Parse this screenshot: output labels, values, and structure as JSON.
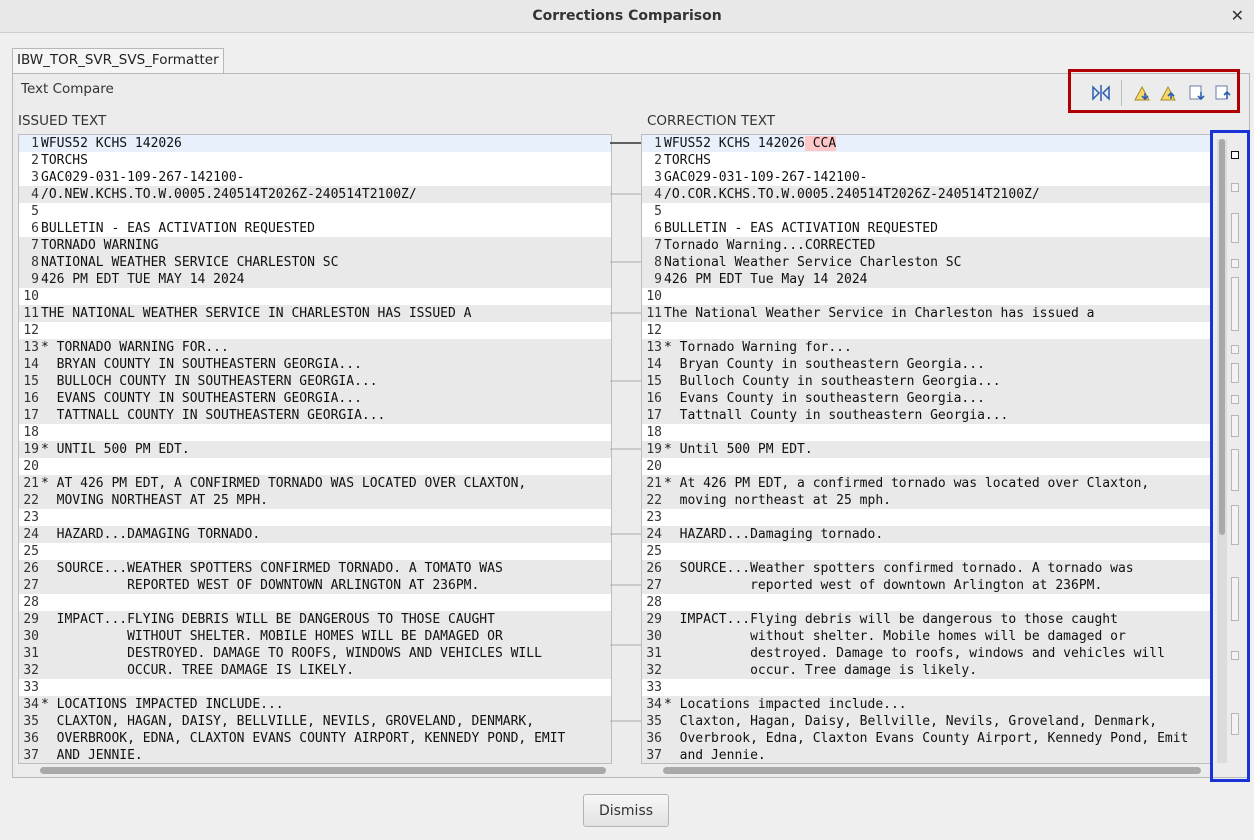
{
  "window": {
    "title": "Corrections Comparison",
    "close_glyph": "✕"
  },
  "tab": {
    "label": "IBW_TOR_SVR_SVS_Formatter"
  },
  "compare_label": "Text Compare",
  "toolbar": {
    "icons": [
      "copy-all-right-icon",
      "next-difference-icon",
      "previous-difference-icon",
      "next-change-icon",
      "previous-change-icon"
    ]
  },
  "left": {
    "header": "ISSUED TEXT",
    "lines": [
      "WFUS52 KCHS 142026",
      "TORCHS",
      "GAC029-031-109-267-142100-",
      "/O.NEW.KCHS.TO.W.0005.240514T2026Z-240514T2100Z/",
      "",
      "BULLETIN - EAS ACTIVATION REQUESTED",
      "TORNADO WARNING",
      "NATIONAL WEATHER SERVICE CHARLESTON SC",
      "426 PM EDT TUE MAY 14 2024",
      "",
      "THE NATIONAL WEATHER SERVICE IN CHARLESTON HAS ISSUED A",
      "",
      "* TORNADO WARNING FOR...",
      "  BRYAN COUNTY IN SOUTHEASTERN GEORGIA...",
      "  BULLOCH COUNTY IN SOUTHEASTERN GEORGIA...",
      "  EVANS COUNTY IN SOUTHEASTERN GEORGIA...",
      "  TATTNALL COUNTY IN SOUTHEASTERN GEORGIA...",
      "",
      "* UNTIL 500 PM EDT.",
      "",
      "* AT 426 PM EDT, A CONFIRMED TORNADO WAS LOCATED OVER CLAXTON,",
      "  MOVING NORTHEAST AT 25 MPH.",
      "",
      "  HAZARD...DAMAGING TORNADO.",
      "",
      "  SOURCE...WEATHER SPOTTERS CONFIRMED TORNADO. A TOMATO WAS",
      "           REPORTED WEST OF DOWNTOWN ARLINGTON AT 236PM.",
      "",
      "  IMPACT...FLYING DEBRIS WILL BE DANGEROUS TO THOSE CAUGHT",
      "           WITHOUT SHELTER. MOBILE HOMES WILL BE DAMAGED OR",
      "           DESTROYED. DAMAGE TO ROOFS, WINDOWS AND VEHICLES WILL",
      "           OCCUR. TREE DAMAGE IS LIKELY.",
      "",
      "* LOCATIONS IMPACTED INCLUDE...",
      "  CLAXTON, HAGAN, DAISY, BELLVILLE, NEVILS, GROVELAND, DENMARK,",
      "  OVERBROOK, EDNA, CLAXTON EVANS COUNTY AIRPORT, KENNEDY POND, EMIT",
      "  AND JENNIE."
    ]
  },
  "right": {
    "header": "CORRECTION TEXT",
    "first_line_main": "WFUS52 KCHS 142026",
    "first_line_added": " CCA",
    "lines": [
      "WFUS52 KCHS 142026 CCA",
      "TORCHS",
      "GAC029-031-109-267-142100-",
      "/O.COR.KCHS.TO.W.0005.240514T2026Z-240514T2100Z/",
      "",
      "BULLETIN - EAS ACTIVATION REQUESTED",
      "Tornado Warning...CORRECTED",
      "National Weather Service Charleston SC",
      "426 PM EDT Tue May 14 2024",
      "",
      "The National Weather Service in Charleston has issued a",
      "",
      "* Tornado Warning for...",
      "  Bryan County in southeastern Georgia...",
      "  Bulloch County in southeastern Georgia...",
      "  Evans County in southeastern Georgia...",
      "  Tattnall County in southeastern Georgia...",
      "",
      "* Until 500 PM EDT.",
      "",
      "* At 426 PM EDT, a confirmed tornado was located over Claxton,",
      "  moving northeast at 25 mph.",
      "",
      "  HAZARD...Damaging tornado.",
      "",
      "  SOURCE...Weather spotters confirmed tornado. A tornado was",
      "           reported west of downtown Arlington at 236PM.",
      "",
      "  IMPACT...Flying debris will be dangerous to those caught",
      "           without shelter. Mobile homes will be damaged or",
      "           destroyed. Damage to roofs, windows and vehicles will",
      "           occur. Tree damage is likely.",
      "",
      "* Locations impacted include...",
      "  Claxton, Hagan, Daisy, Bellville, Nevils, Groveland, Denmark,",
      "  Overbrook, Edna, Claxton Evans County Airport, Kennedy Pond, Emit",
      "  and Jennie."
    ]
  },
  "dismiss_label": "Dismiss"
}
